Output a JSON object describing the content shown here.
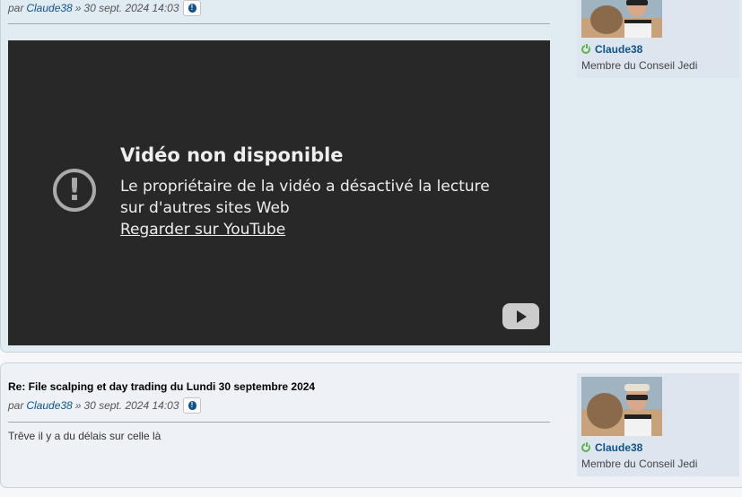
{
  "posts": [
    {
      "author_prefix": "par",
      "author": "Claude38",
      "separator": "»",
      "date": "30 sept. 2024 14:03",
      "video": {
        "title": "Vidéo non disponible",
        "message": "Le propriétaire de la vidéo a désactivé la lecture sur d'autres sites Web",
        "link": "Regarder sur YouTube",
        "warning_icon": "!"
      },
      "profile": {
        "username": "Claude38",
        "rank": "Membre du Conseil Jedi"
      }
    },
    {
      "title": "Re: File scalping et day trading du Lundi 30 septembre 2024",
      "author_prefix": "par",
      "author": "Claude38",
      "separator": "»",
      "date": "30 sept. 2024 14:03",
      "body": "Trêve il y a du délais sur celle là",
      "profile": {
        "username": "Claude38",
        "rank": "Membre du Conseil Jedi"
      }
    }
  ],
  "icons": {
    "report": "report-icon",
    "online": "online-status-icon",
    "youtube": "youtube-logo-icon"
  },
  "colors": {
    "link": "#105289",
    "post_bg": "#e1ebf2",
    "video_bg": "#282828",
    "online": "#5bb54a"
  }
}
